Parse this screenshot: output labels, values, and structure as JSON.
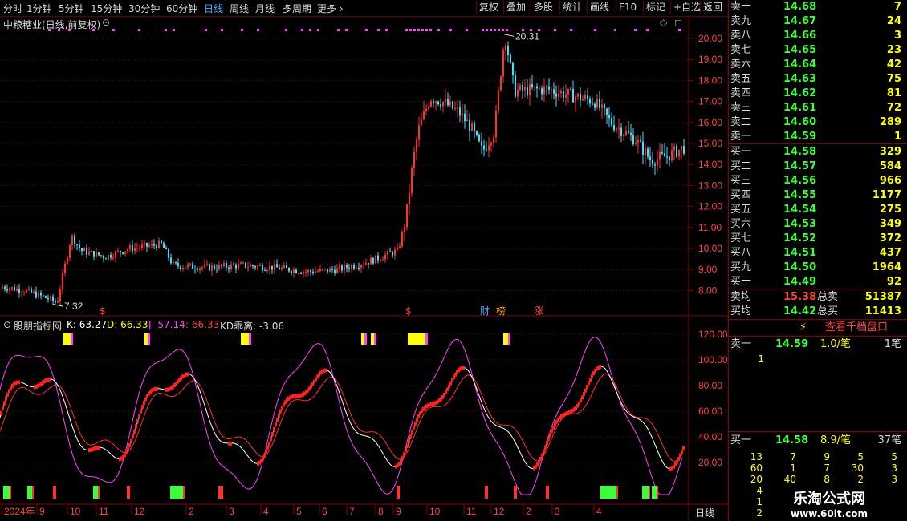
{
  "toolbar": {
    "periods": [
      "分时",
      "1分钟",
      "5分钟",
      "15分钟",
      "30分钟",
      "60分钟",
      "日线",
      "周线",
      "月线",
      "多周期",
      "更多"
    ],
    "active_period": "日线",
    "buttons": [
      "复权",
      "叠加",
      "多股",
      "统计",
      "画线",
      "F10",
      "标记",
      "+自选",
      "返回"
    ]
  },
  "main_chart": {
    "title": "中粮糖业(日线,前复权)",
    "high_label": "20.31",
    "low_label": "7.32",
    "price_axis": [
      "20.00",
      "19.00",
      "18.00",
      "17.00",
      "16.00",
      "15.00",
      "14.00",
      "13.00",
      "12.00",
      "11.00",
      "10.00",
      "9.00",
      "8.00"
    ],
    "markers": [
      "$",
      "$",
      "财",
      "榜",
      "涨"
    ]
  },
  "indicator": {
    "name": "股朋指标网",
    "k_label": "K: 63.27",
    "d_label": "D: 66.33",
    "j_label": "J: 57.14",
    "extra_label": ": 66.33",
    "kd_label": "KD乖离: -3.06",
    "axis": [
      "120.00",
      "100.00",
      "80.00",
      "60.00",
      "40.00",
      "20.00"
    ]
  },
  "date_axis": {
    "labels": [
      "2024年",
      "9",
      "10",
      "11",
      "12",
      "2",
      "3",
      "4",
      "5",
      "6",
      "7",
      "8",
      "9",
      "10",
      "11",
      "12",
      "2",
      "3",
      "4"
    ],
    "period_button": "日线"
  },
  "order_book": {
    "asks": [
      {
        "label": "卖十",
        "price": "14.68",
        "vol": "7"
      },
      {
        "label": "卖九",
        "price": "14.67",
        "vol": "24"
      },
      {
        "label": "卖八",
        "price": "14.66",
        "vol": "3"
      },
      {
        "label": "卖七",
        "price": "14.65",
        "vol": "23"
      },
      {
        "label": "卖六",
        "price": "14.64",
        "vol": "42"
      },
      {
        "label": "卖五",
        "price": "14.63",
        "vol": "75"
      },
      {
        "label": "卖四",
        "price": "14.62",
        "vol": "81"
      },
      {
        "label": "卖三",
        "price": "14.61",
        "vol": "72"
      },
      {
        "label": "卖二",
        "price": "14.60",
        "vol": "289"
      },
      {
        "label": "卖一",
        "price": "14.59",
        "vol": "1"
      }
    ],
    "bids": [
      {
        "label": "买一",
        "price": "14.58",
        "vol": "329"
      },
      {
        "label": "买二",
        "price": "14.57",
        "vol": "584"
      },
      {
        "label": "买三",
        "price": "14.56",
        "vol": "966"
      },
      {
        "label": "买四",
        "price": "14.55",
        "vol": "1177"
      },
      {
        "label": "买五",
        "price": "14.54",
        "vol": "275"
      },
      {
        "label": "买六",
        "price": "14.53",
        "vol": "349"
      },
      {
        "label": "买七",
        "price": "14.52",
        "vol": "372"
      },
      {
        "label": "买八",
        "price": "14.51",
        "vol": "437"
      },
      {
        "label": "买九",
        "price": "14.50",
        "vol": "1964"
      },
      {
        "label": "买十",
        "price": "14.49",
        "vol": "92"
      }
    ],
    "ask_avg": {
      "label": "卖均",
      "price": "15.38",
      "total_label": "总卖",
      "total": "51387"
    },
    "bid_avg": {
      "label": "买均",
      "price": "14.42",
      "total_label": "总买",
      "total": "11413"
    },
    "depth_button": "查看千档盘口",
    "ask1_detail": {
      "label": "卖一",
      "price": "14.59",
      "avg": "1.0/笔",
      "count": "1笔",
      "queue": [
        "1"
      ]
    },
    "bid1_detail": {
      "label": "买一",
      "price": "14.58",
      "avg": "8.9/笔",
      "count": "37笔"
    },
    "bid_queue": [
      [
        "13",
        "7",
        "9",
        "5",
        "5"
      ],
      [
        "60",
        "1",
        "7",
        "30",
        "3"
      ],
      [
        "20",
        "40",
        "8",
        "2",
        "3"
      ],
      [
        "4",
        "",
        "",
        "",
        ""
      ],
      [
        "1",
        "",
        "",
        "",
        ""
      ],
      [
        "2",
        "",
        "",
        "",
        ""
      ]
    ]
  },
  "watermark": {
    "line1": "乐淘公式网",
    "line2": "www.60lt.com"
  },
  "colors": {
    "up": "#ff3030",
    "down": "#40e0ff",
    "grid": "#8a0000",
    "green": "#3cff3c",
    "yellow": "#ffff00",
    "magenta": "#ff40ff"
  }
}
